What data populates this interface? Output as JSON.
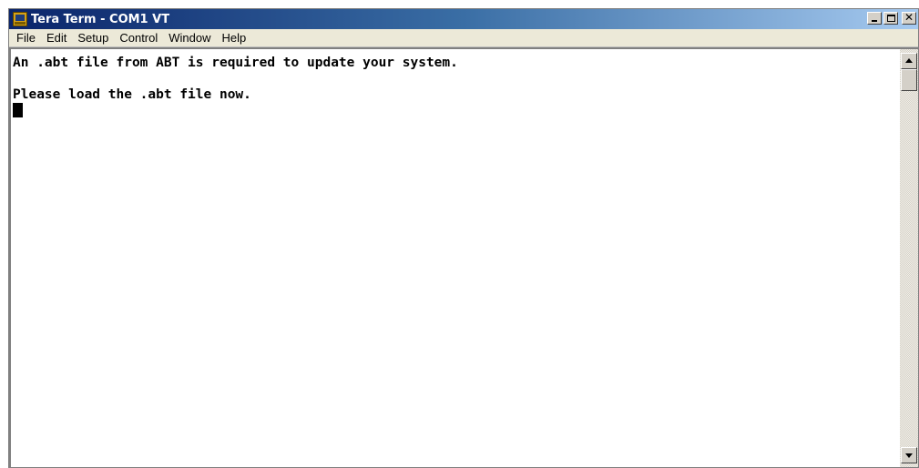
{
  "window": {
    "title": "Tera Term - COM1 VT"
  },
  "menu": {
    "items": [
      "File",
      "Edit",
      "Setup",
      "Control",
      "Window",
      "Help"
    ]
  },
  "terminal": {
    "lines": [
      "An .abt file from ABT is required to update your system.",
      "",
      "Please load the .abt file now."
    ]
  },
  "icons": {
    "app": "tera-term-icon",
    "minimize": "minimize-icon",
    "maximize": "maximize-icon",
    "close": "close-icon",
    "scroll_up": "arrow-up-icon",
    "scroll_down": "arrow-down-icon"
  },
  "colors": {
    "titlebar_start": "#0a246a",
    "titlebar_end": "#a6caf0",
    "terminal_bg": "#ffffff",
    "terminal_fg": "#000000"
  }
}
